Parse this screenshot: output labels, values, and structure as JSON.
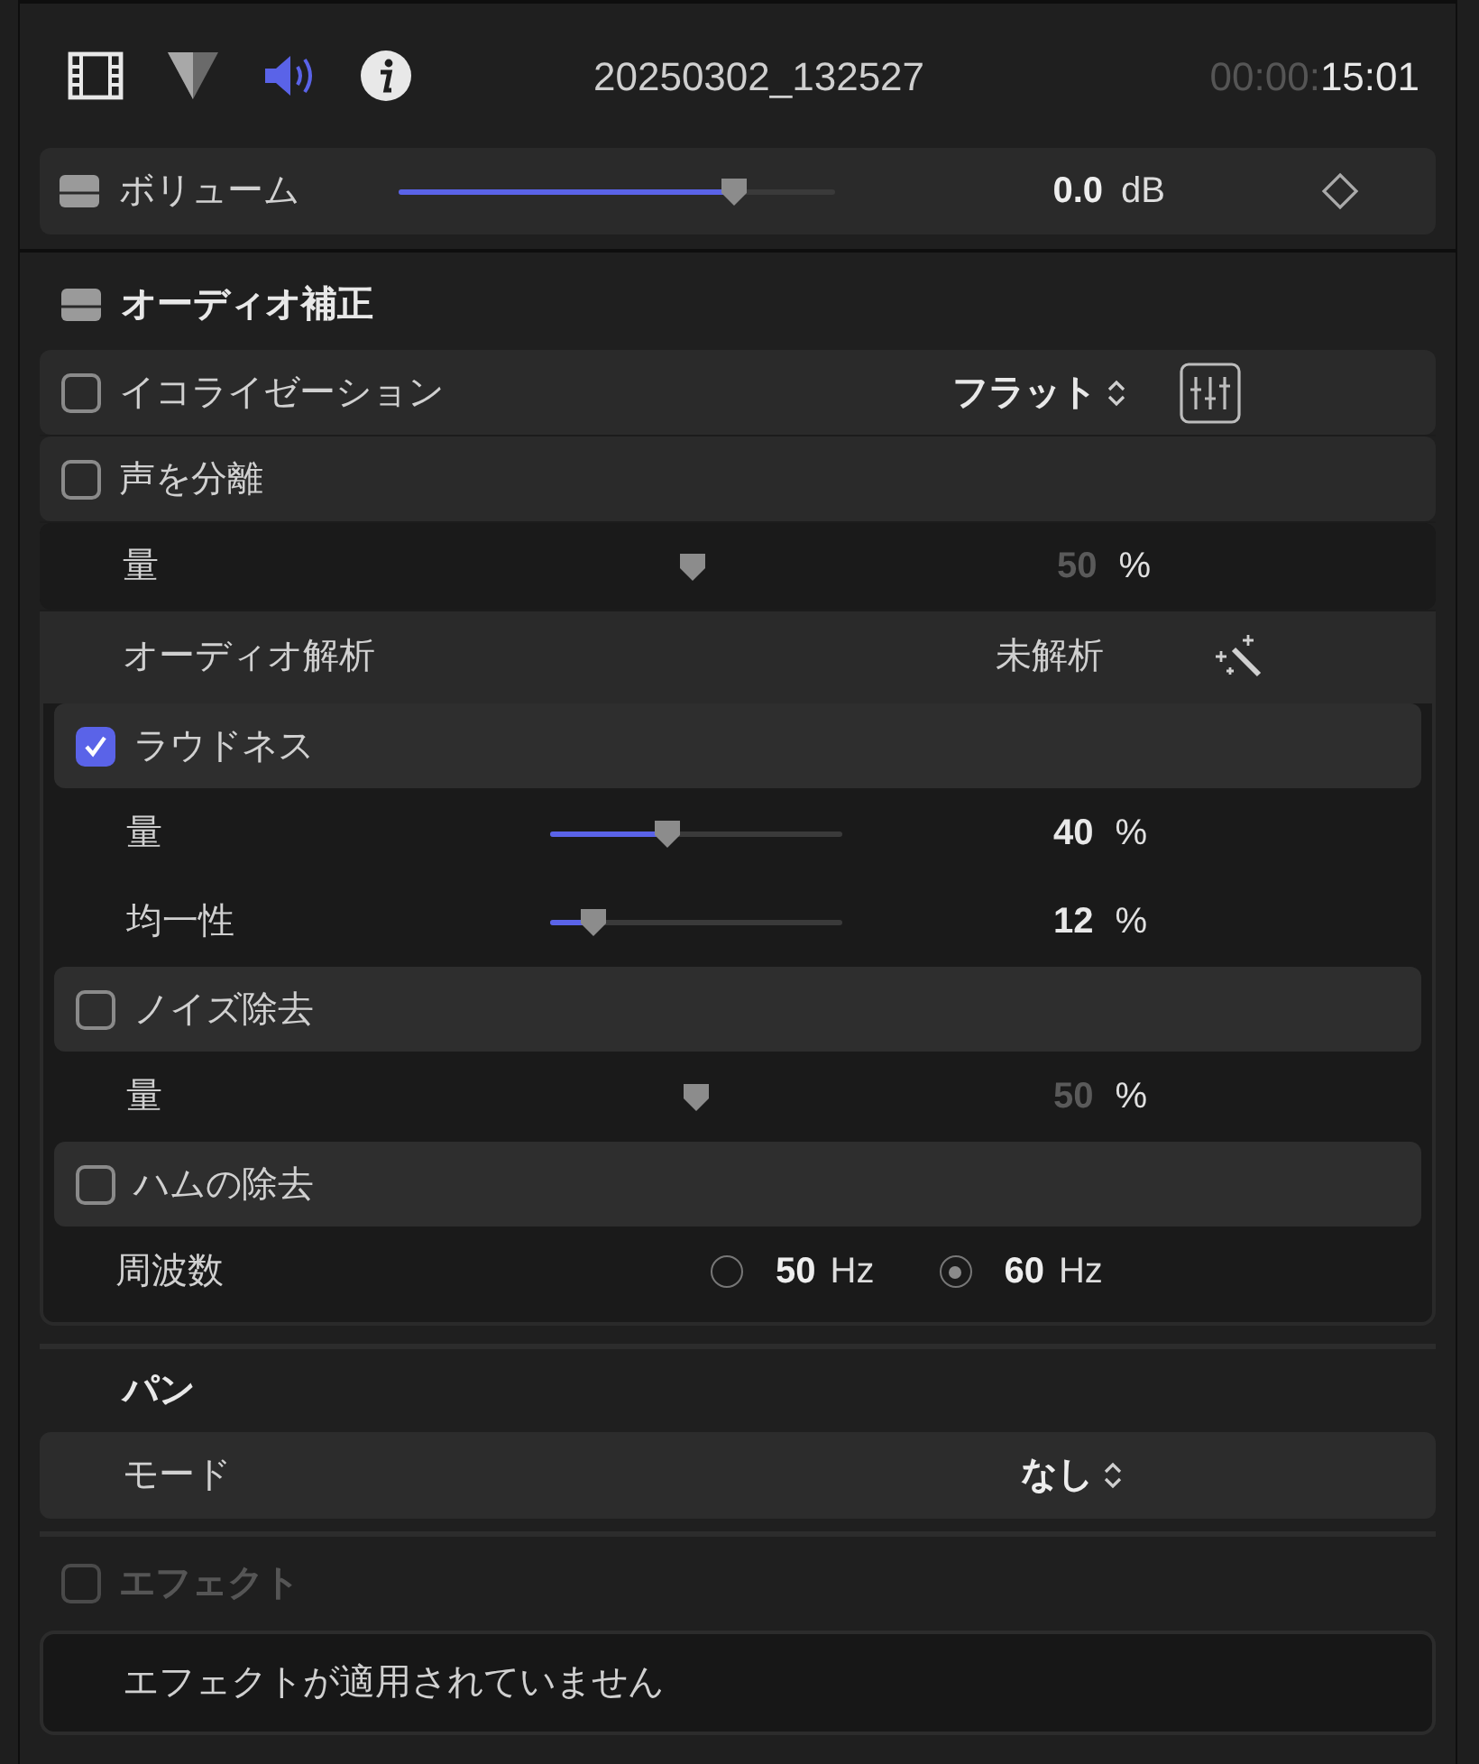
{
  "toolbar": {
    "tabs": [
      {
        "kind": "film",
        "selected": false
      },
      {
        "kind": "color",
        "selected": false
      },
      {
        "kind": "audio",
        "selected": true
      },
      {
        "kind": "info",
        "selected": false
      }
    ],
    "title": "20250302_132527",
    "timecode_dim": "00:00:",
    "timecode": "15:01"
  },
  "volume": {
    "label": "ボリューム",
    "level": 0.77,
    "value": "0.0",
    "unit": "dB"
  },
  "audio_enhancement": {
    "title": "オーディオ補正",
    "rows": [
      {
        "kind": "check",
        "label": "イコライゼーション",
        "checked": false,
        "value": "フラット"
      },
      {
        "kind": "check",
        "label": "声を分離",
        "checked": false
      },
      {
        "kind": "slider",
        "label": "量",
        "level": 0.5,
        "value": "50",
        "unit": "%",
        "disabled": true
      },
      {
        "kind": "status",
        "label": "オーディオ解析",
        "value": "未解析"
      }
    ],
    "analysis_rows": [
      {
        "kind": "check",
        "label": "ラウドネス",
        "checked": true
      },
      {
        "kind": "slider",
        "label": "量",
        "level": 0.4,
        "value": "40",
        "unit": "%",
        "disabled": false
      },
      {
        "kind": "slider",
        "label": "均一性",
        "level": 0.15,
        "value": "12",
        "unit": "%",
        "disabled": false
      },
      {
        "kind": "check",
        "label": "ノイズ除去",
        "checked": false
      },
      {
        "kind": "slider",
        "label": "量",
        "level": 0.5,
        "value": "50",
        "unit": "%",
        "disabled": true
      },
      {
        "kind": "check",
        "label": "ハムの除去",
        "checked": false
      },
      {
        "kind": "radio",
        "label": "周波数",
        "options": [
          {
            "value": "50",
            "unit": "Hz",
            "selected": false
          },
          {
            "value": "60",
            "unit": "Hz",
            "selected": true
          }
        ]
      }
    ]
  },
  "pan": {
    "title": "パン",
    "mode_label": "モード",
    "mode_value": "なし"
  },
  "effects": {
    "label": "エフェクト",
    "checked": false,
    "disabled": true,
    "empty_message": "エフェクトが適用されていません"
  }
}
